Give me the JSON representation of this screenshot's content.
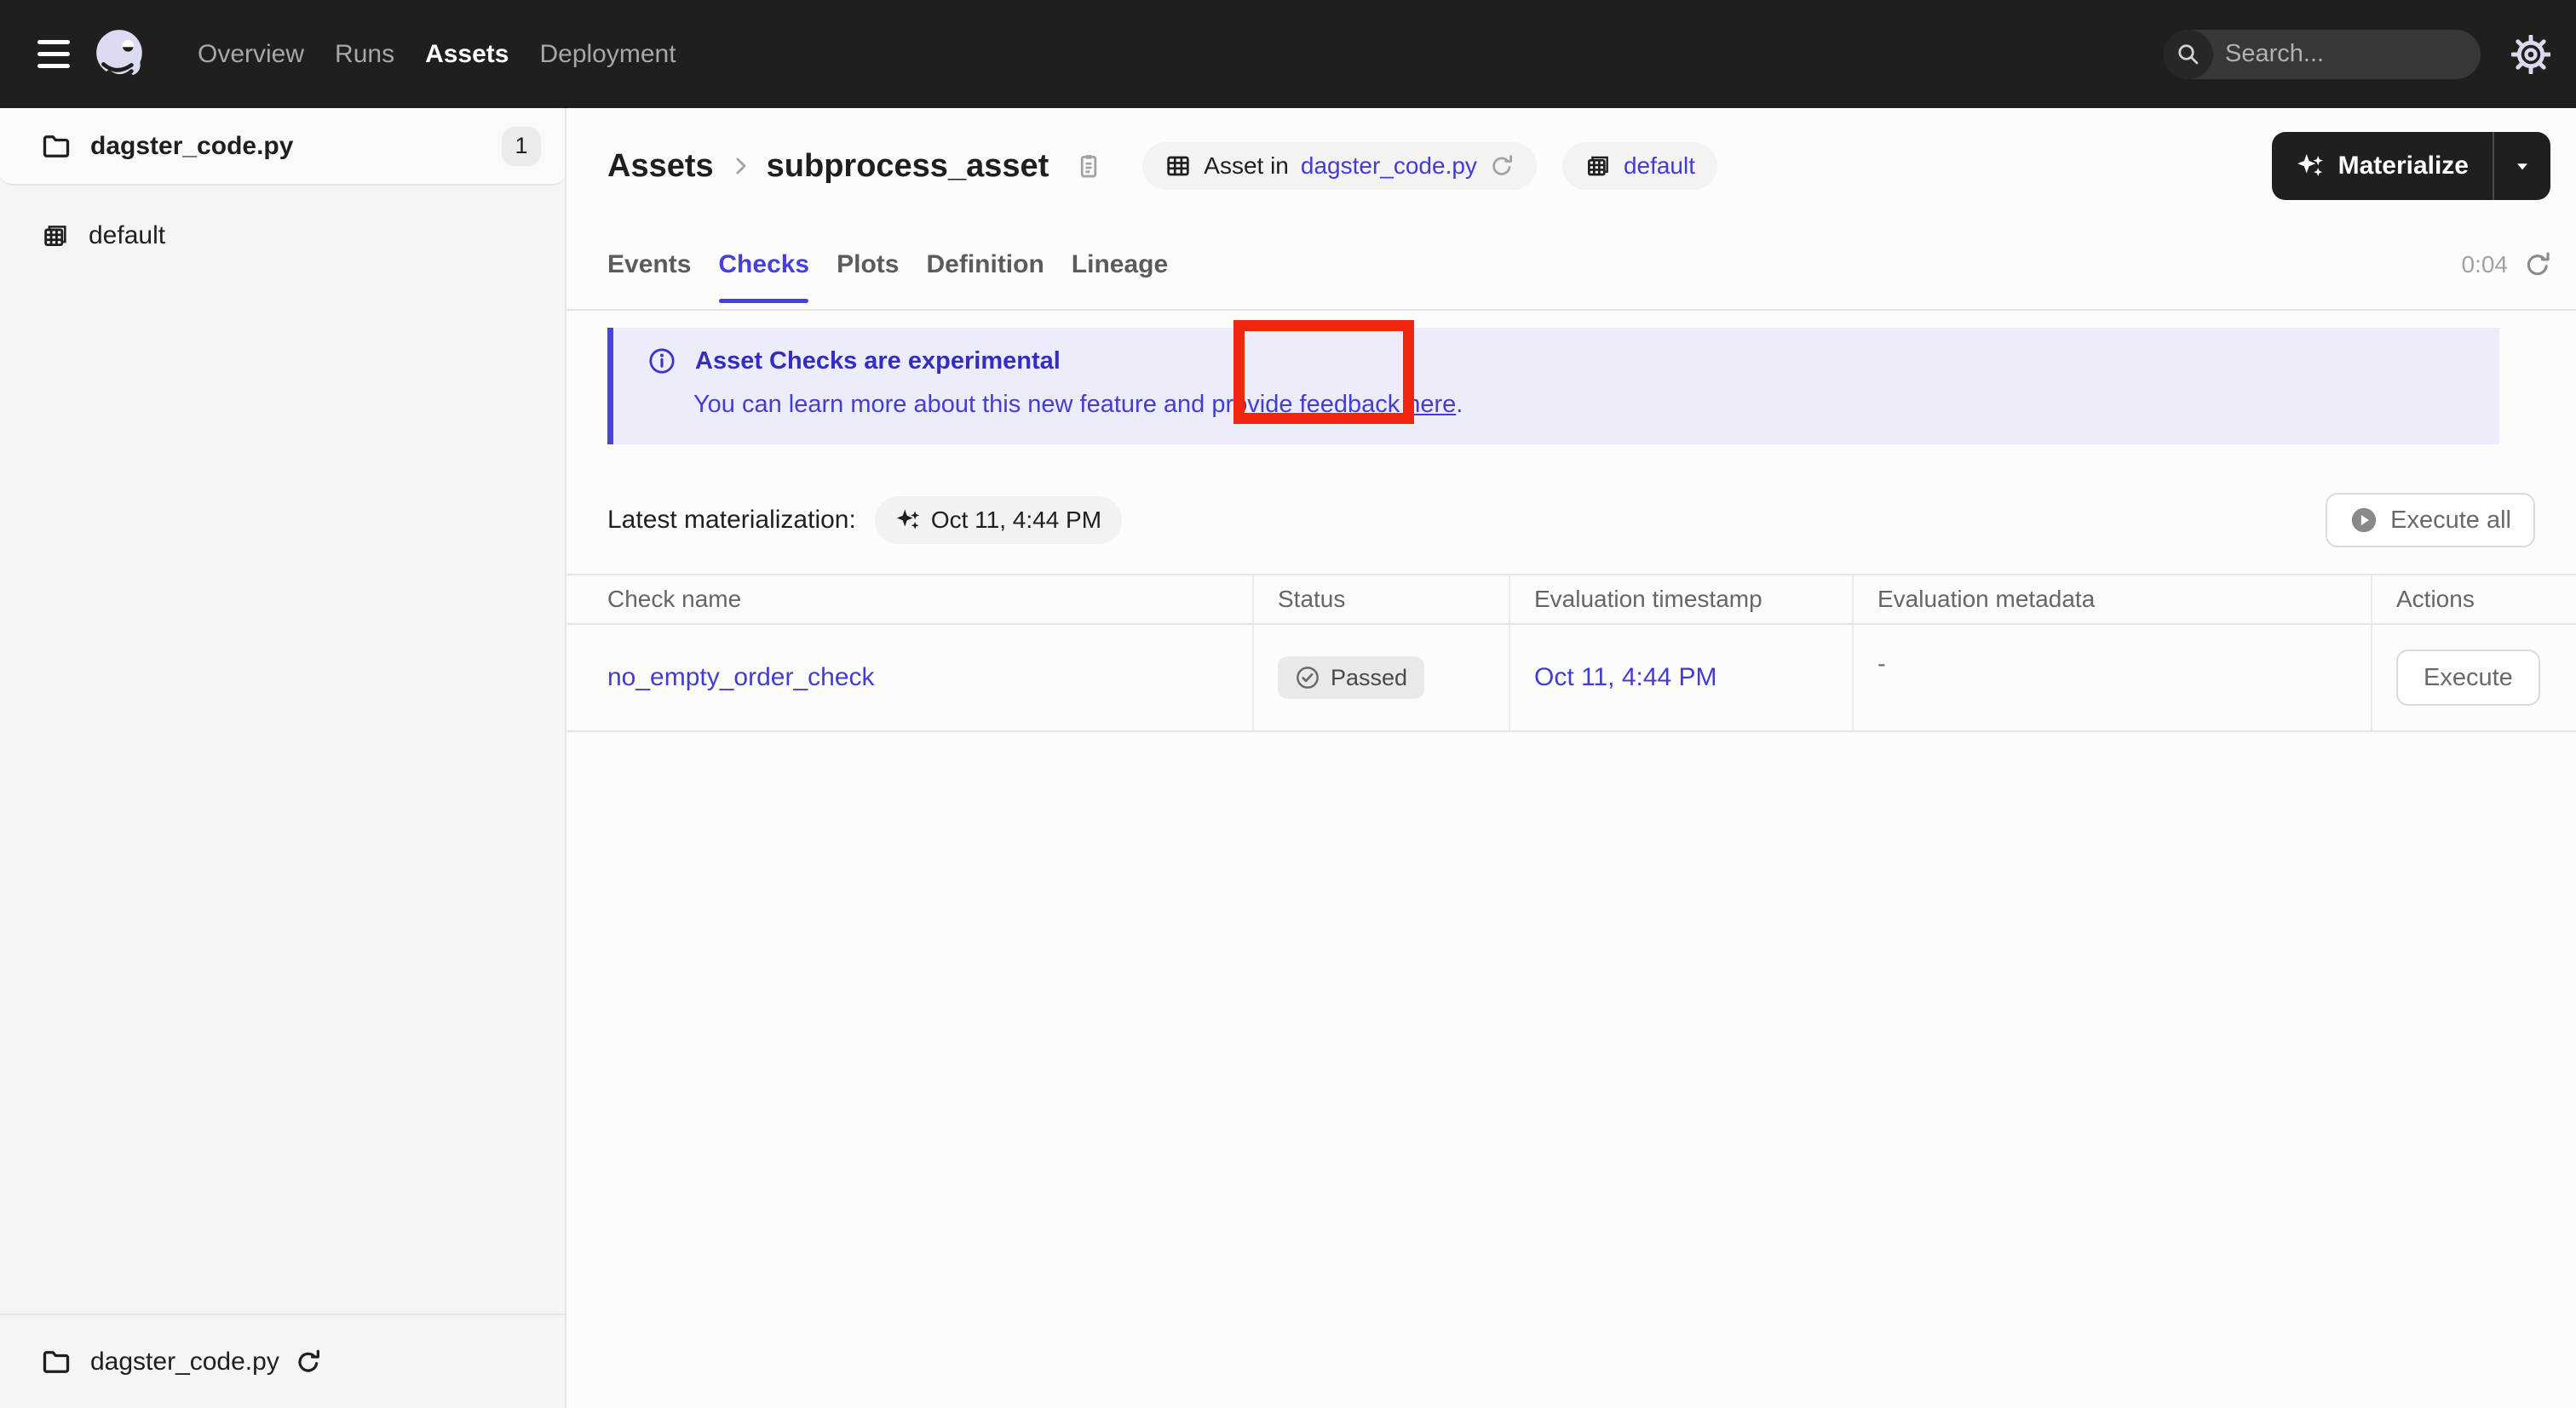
{
  "colors": {
    "navbar_bg": "#211e1e",
    "accent_indigo": "#453fdb",
    "link_indigo": "#423cd4",
    "banner_bg": "#ececfa",
    "annotation_red": "#f0250f",
    "sidebar_bg": "#f6f5f3"
  },
  "icons": {
    "menu": "hamburger",
    "logo": "dagster-octopus",
    "search": "magnifier",
    "settings": "gear",
    "folder": "folder-outline",
    "repo": "layered-grid",
    "asset": "table-grid",
    "copy": "clipboard",
    "reload": "refresh-arrow",
    "sparkle": "four-point-star",
    "info": "info-circle",
    "check": "check-circle",
    "play": "play-circle",
    "caret": "caret-down",
    "chevron": "chevron-right"
  },
  "navbar": {
    "items": [
      {
        "label": "Overview"
      },
      {
        "label": "Runs"
      },
      {
        "label": "Assets"
      },
      {
        "label": "Deployment"
      }
    ],
    "search_placeholder": "Search...",
    "search_shortcut": "/"
  },
  "sidebar": {
    "top_item": {
      "label": "dagster_code.py",
      "badge": "1"
    },
    "group_item": {
      "label": "default"
    },
    "bottom_item": {
      "label": "dagster_code.py"
    }
  },
  "header": {
    "breadcrumb": [
      "Assets",
      "subprocess_asset"
    ],
    "asset_chip": {
      "prefix": "Asset in",
      "link": "dagster_code.py"
    },
    "repo_chip": "default",
    "materialize_label": "Materialize"
  },
  "tabs": {
    "items": [
      "Events",
      "Checks",
      "Plots",
      "Definition",
      "Lineage"
    ],
    "active": "Checks",
    "timer": "0:04"
  },
  "banner": {
    "title": "Asset Checks are experimental",
    "body_prefix": "You can learn more about this new feature and provide feedback",
    "link_label": "here",
    "body_suffix": "."
  },
  "toolbar": {
    "latest_label": "Latest materialization:",
    "latest_value": "Oct 11, 4:44 PM",
    "execute_all_label": "Execute all"
  },
  "table": {
    "columns": [
      "Check name",
      "Status",
      "Evaluation timestamp",
      "Evaluation metadata",
      "Actions"
    ],
    "rows": [
      {
        "name": "no_empty_order_check",
        "status": "Passed",
        "timestamp": "Oct 11, 4:44 PM",
        "metadata": "-",
        "action_label": "Execute"
      }
    ]
  }
}
